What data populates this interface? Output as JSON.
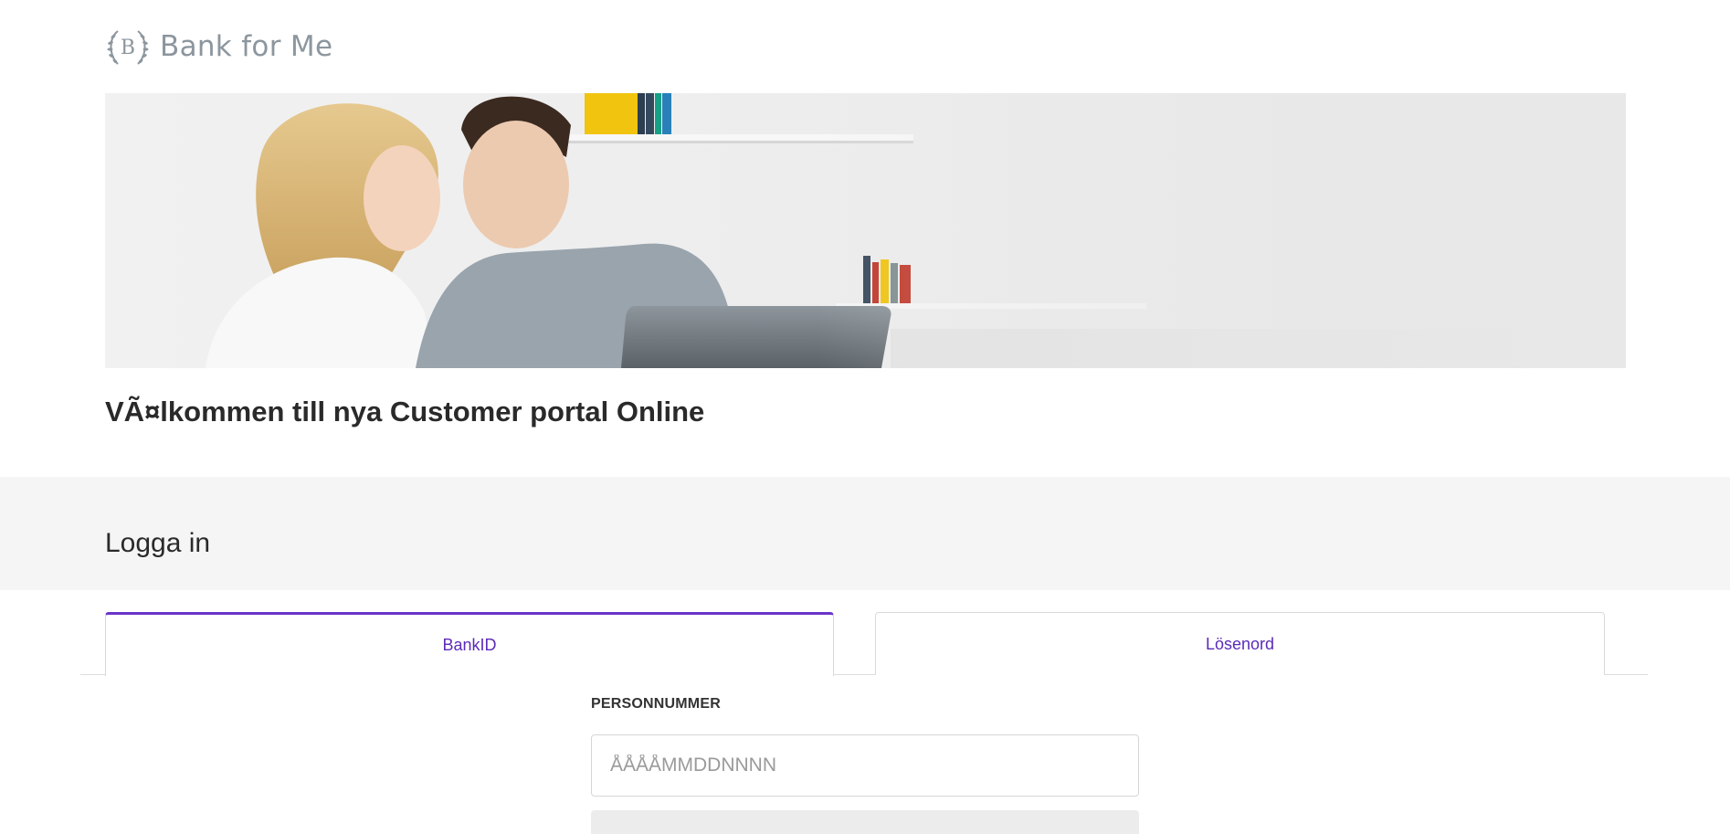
{
  "brand": {
    "name": "Bank for Me",
    "logo_icon": "laurel-b-icon",
    "logo_letter": "B"
  },
  "hero": {
    "image_subject": "hero-couple-laptop-image"
  },
  "welcome_heading": "VÃ¤lkommen till nya Customer portal Online",
  "login": {
    "heading": "Logga in",
    "tabs": [
      {
        "label": "BankID",
        "active": true
      },
      {
        "label": "Lösenord",
        "active": false
      }
    ],
    "field_label": "PERSONNUMMER",
    "field_placeholder": "ÅÅÅÅMMDDNNNN",
    "field_value": ""
  },
  "colors": {
    "accent": "#6a35c9",
    "tab_text": "#5b2bb8",
    "band_bg": "#f5f5f5",
    "logo_grey": "#8c969e"
  }
}
